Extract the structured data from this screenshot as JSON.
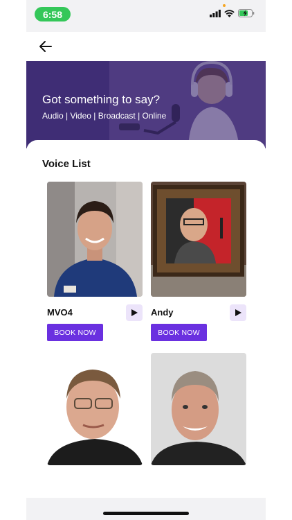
{
  "status": {
    "time": "6:58",
    "icons": [
      "signal-icon",
      "wifi-icon",
      "battery-charging-icon"
    ],
    "time_pill_color": "#34c759"
  },
  "appbar": {
    "back_icon": "arrow-left-icon"
  },
  "hero": {
    "title": "Got something to say?",
    "subtitle": "Audio | Video | Broadcast | Online"
  },
  "voice_list": {
    "title": "Voice List",
    "items": [
      {
        "name": "MVO4",
        "book_label": "BOOK NOW"
      },
      {
        "name": "Andy",
        "book_label": "BOOK NOW"
      },
      {
        "name": "",
        "book_label": ""
      },
      {
        "name": "",
        "book_label": ""
      }
    ]
  },
  "colors": {
    "accent": "#6a30e0",
    "play_bg": "#ece4fa",
    "hero_tint": "#4a3780"
  }
}
